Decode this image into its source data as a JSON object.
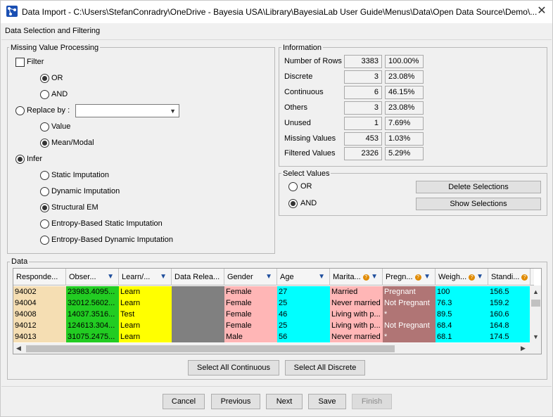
{
  "window": {
    "title": "Data Import - C:\\Users\\StefanConradry\\OneDrive - Bayesia USA\\Library\\BayesiaLab User Guide\\Menus\\Data\\Open Data Source\\Demo\\...",
    "close_glyph": "✕"
  },
  "panel": {
    "title": "Data Selection and Filtering"
  },
  "missing": {
    "legend": "Missing Value Processing",
    "filter_label": "Filter",
    "or_label": "OR",
    "and_label": "AND",
    "replace_label": "Replace by :",
    "replace_value": "",
    "value_label": "Value",
    "mean_label": "Mean/Modal",
    "infer_label": "Infer",
    "static_label": "Static Imputation",
    "dynamic_label": "Dynamic Imputation",
    "structural_label": "Structural EM",
    "entropy_static_label": "Entropy-Based Static Imputation",
    "entropy_dynamic_label": "Entropy-Based Dynamic Imputation"
  },
  "information": {
    "legend": "Information",
    "rows": [
      {
        "label": "Number of Rows",
        "count": "3383",
        "pct": "100.00%"
      },
      {
        "label": "Discrete",
        "count": "3",
        "pct": "23.08%"
      },
      {
        "label": "Continuous",
        "count": "6",
        "pct": "46.15%"
      },
      {
        "label": "Others",
        "count": "3",
        "pct": "23.08%"
      },
      {
        "label": "Unused",
        "count": "1",
        "pct": "7.69%"
      },
      {
        "label": "Missing Values",
        "count": "453",
        "pct": "1.03%"
      },
      {
        "label": "Filtered Values",
        "count": "2326",
        "pct": "5.29%"
      }
    ]
  },
  "select_values": {
    "legend": "Select Values",
    "or_label": "OR",
    "and_label": "AND",
    "delete_label": "Delete Selections",
    "show_label": "Show Selections"
  },
  "data": {
    "legend": "Data",
    "columns": [
      "Responde...",
      "Obser...",
      "Learn/...",
      "Data Relea...",
      "Gender",
      "Age",
      "Marita...",
      "Pregn...",
      "Weigh...",
      "Standi..."
    ],
    "rows": [
      [
        "94002",
        "23983.4095...",
        "Learn",
        "",
        "Female",
        "27",
        "Married",
        "Pregnant",
        "100",
        "156.5"
      ],
      [
        "94004",
        "32012.5602...",
        "Learn",
        "",
        "Female",
        "25",
        "Never married",
        "Not Pregnant",
        "76.3",
        "159.2"
      ],
      [
        "94008",
        "14037.3516...",
        "Test",
        "",
        "Female",
        "46",
        "Living with p...",
        "*",
        "89.5",
        "160.6"
      ],
      [
        "94012",
        "124613.304...",
        "Learn",
        "",
        "Female",
        "25",
        "Living with p...",
        "Not Pregnant",
        "68.4",
        "164.8"
      ],
      [
        "94013",
        "31075.2475...",
        "Learn",
        "",
        "Male",
        "56",
        "Never married",
        "*",
        "68.1",
        "174.5"
      ]
    ],
    "column_colors": [
      "#f5deb3",
      "#22cc22",
      "#ffff00",
      "#808080",
      "#ffb6b6",
      "#00ffff",
      "#ffb6b6",
      "#b07575",
      "#00ffff",
      "#00ffff"
    ],
    "select_all_continuous": "Select All Continuous",
    "select_all_discrete": "Select All Discrete"
  },
  "footer": {
    "cancel": "Cancel",
    "previous": "Previous",
    "next": "Next",
    "save": "Save",
    "finish": "Finish"
  }
}
